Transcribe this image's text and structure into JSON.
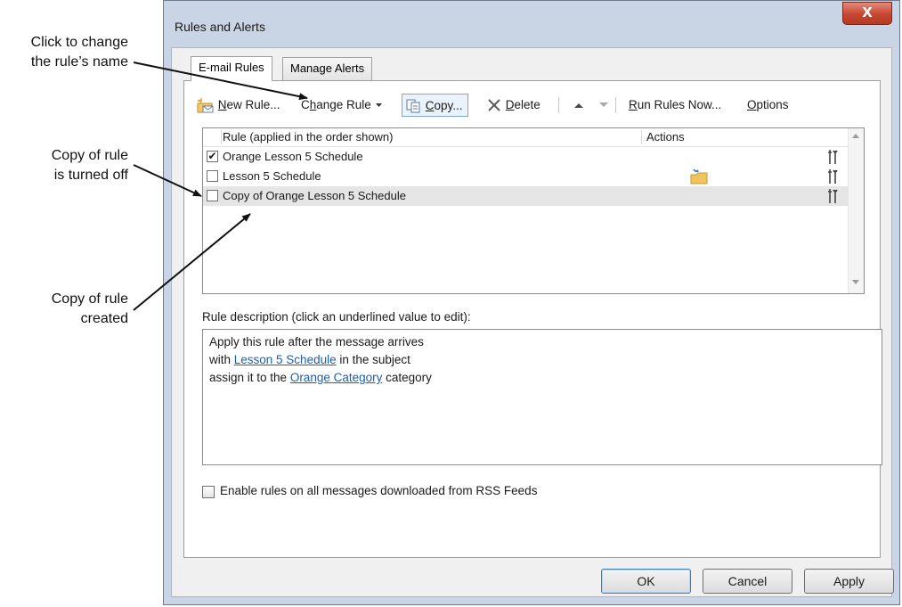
{
  "callouts": {
    "change_name": [
      "Click to change",
      "the rule’s name"
    ],
    "turned_off": [
      "Copy of rule",
      "is turned off"
    ],
    "created": [
      "Copy of rule",
      "created"
    ]
  },
  "dialog": {
    "title": "Rules and Alerts",
    "close_glyph": "X"
  },
  "tabs": [
    {
      "label": "E-mail Rules",
      "active": true
    },
    {
      "label": "Manage Alerts",
      "active": false
    }
  ],
  "toolbar": {
    "new_rule": {
      "accel": "N",
      "rest": "ew Rule..."
    },
    "change_rule": {
      "pre": "C",
      "accel": "h",
      "rest": "ange Rule"
    },
    "copy": {
      "accel": "C",
      "rest": "opy..."
    },
    "delete": {
      "accel": "D",
      "rest": "elete"
    },
    "run_rules_now": {
      "accel": "R",
      "rest": "un Rules Now..."
    },
    "options": {
      "accel": "O",
      "rest": "ptions"
    }
  },
  "rules_list": {
    "columns": [
      "Rule (applied in the order shown)",
      "Actions"
    ],
    "rows": [
      {
        "name": "Orange Lesson 5 Schedule",
        "checked": true,
        "check_glyph": "✔",
        "has_move_action": false,
        "selected": false
      },
      {
        "name": "Lesson 5 Schedule",
        "checked": false,
        "check_glyph": "",
        "has_move_action": true,
        "selected": false
      },
      {
        "name": "Copy of Orange Lesson 5 Schedule",
        "checked": false,
        "check_glyph": "",
        "has_move_action": false,
        "selected": true
      }
    ]
  },
  "description": {
    "label": "Rule description (click an underlined value to edit):",
    "line1": "Apply this rule after the message arrives",
    "line2_pre": "with ",
    "line2_link": "Lesson 5 Schedule",
    "line2_post": " in the subject",
    "line3_pre": "assign it to the ",
    "line3_link": "Orange Category",
    "line3_post": " category"
  },
  "rss_option": {
    "label": "Enable rules on all messages downloaded from RSS Feeds",
    "checked": false
  },
  "buttons": {
    "ok": "OK",
    "cancel": "Cancel",
    "apply": "Apply"
  },
  "colors": {
    "link": "#1a5fb4",
    "close_button": "#c7472f",
    "selection": "#e5e5e5"
  }
}
